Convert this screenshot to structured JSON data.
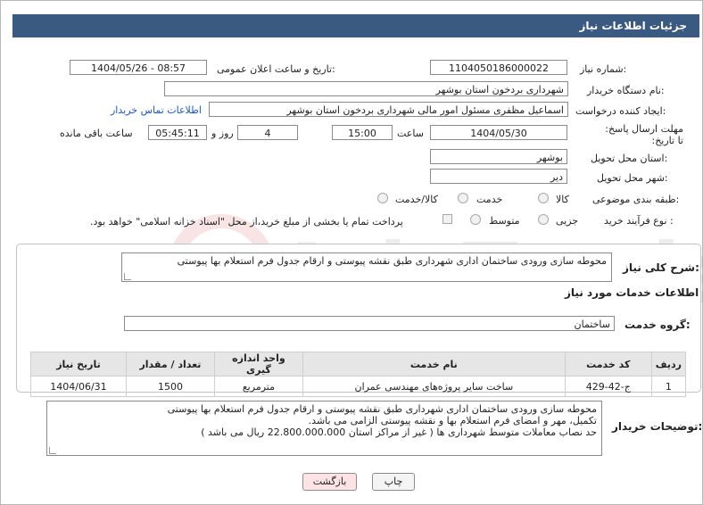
{
  "header": {
    "title": "جزئیات اطلاعات نیاز"
  },
  "form": {
    "need_number_label": "شماره نیاز:",
    "need_number": "1104050186000022",
    "announce_label": "تاریخ و ساعت اعلان عمومی:",
    "announce_value": "1404/05/26 - 08:57",
    "buyer_org_label": "نام دستگاه خریدار:",
    "buyer_org": "شهرداری بردخون استان بوشهر",
    "creator_label": "ایجاد کننده درخواست:",
    "creator": "اسماعیل مظفری مسئول امور مالی شهرداری بردخون استان بوشهر",
    "contact_link": "اطلاعات تماس خریدار",
    "deadline_label": "مهلت ارسال پاسخ: تا تاریخ:",
    "deadline_date": "1404/05/30",
    "time_label": "ساعت",
    "deadline_time": "15:00",
    "days_value": "4",
    "days_label": "روز و",
    "remaining_time": "05:45:11",
    "remaining_label": "ساعت باقی مانده",
    "province_label": "استان محل تحویل:",
    "province": "بوشهر",
    "city_label": "شهر محل تحویل:",
    "city": "دیر",
    "category_label": "طبقه بندی موضوعی:",
    "category_options": [
      "کالا",
      "خدمت",
      "کالا/خدمت"
    ],
    "category_selected": "خدمت",
    "purchase_label": "نوع فرآیند خرید :",
    "purchase_options": [
      "جزیی",
      "متوسط"
    ],
    "purchase_selected": "متوسط",
    "payment_note": "پرداخت تمام یا بخشی از مبلغ خرید،از محل \"اسناد خزانه اسلامی\" خواهد بود."
  },
  "general": {
    "summary_label": "شرح کلی نیاز:",
    "summary": "محوطه سازی ورودی ساختمان اداری شهرداری طبق نقشه پیوستی و ارقام جدول فرم استعلام بها پیوستی",
    "services_title": "اطلاعات خدمات مورد نیاز",
    "service_group_label": "گروه خدمت:",
    "service_group": "ساختمان"
  },
  "table": {
    "headers": [
      "ردیف",
      "کد خدمت",
      "نام خدمت",
      "واحد اندازه گیری",
      "تعداد / مقدار",
      "تاریخ نیاز"
    ],
    "rows": [
      [
        "1",
        "ج-42-429",
        "ساخت سایر پروژه‌های مهندسی عمران",
        "مترمربع",
        "1500",
        "1404/06/31"
      ]
    ]
  },
  "buyer_notes": {
    "label": "توضیحات خریدار:",
    "lines": [
      "محوطه سازی ورودی ساختمان اداری شهرداری طبق نقشه پیوستی و ارقام جدول فرم استعلام بها پیوستی",
      "تکمیل، مهر و امضای فرم استعلام بها و نقشه پیوستی الزامی می باشد.",
      "حد نصاب معاملات متوسط شهرداری ها ( غیر از مراکز استان 22.800.000.000 ریال می باشد )"
    ]
  },
  "buttons": {
    "print": "چاپ",
    "back": "بازگشت"
  },
  "watermark_text": "AriaTender.neT",
  "colors": {
    "header_bg": "#3b5a82",
    "link": "#1a56c9",
    "back_button_bg": "#fde3e3",
    "table_header_bg": "#e6e6e6"
  }
}
